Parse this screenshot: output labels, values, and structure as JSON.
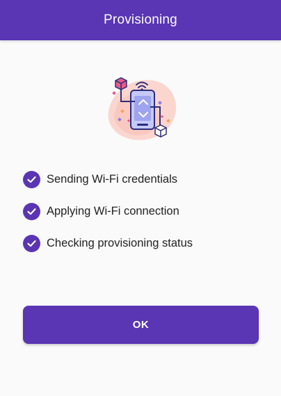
{
  "appbar": {
    "title": "Provisioning",
    "color": "#5a35b4"
  },
  "illustration": {
    "icon": "phone-wifi-provisioning-illustration"
  },
  "steps": [
    {
      "label": "Sending Wi-Fi credentials",
      "status": "done",
      "icon": "check-circle-icon"
    },
    {
      "label": "Applying Wi-Fi connection",
      "status": "done",
      "icon": "check-circle-icon"
    },
    {
      "label": "Checking provisioning status",
      "status": "done",
      "icon": "check-circle-icon"
    }
  ],
  "actions": {
    "ok_label": "OK"
  }
}
